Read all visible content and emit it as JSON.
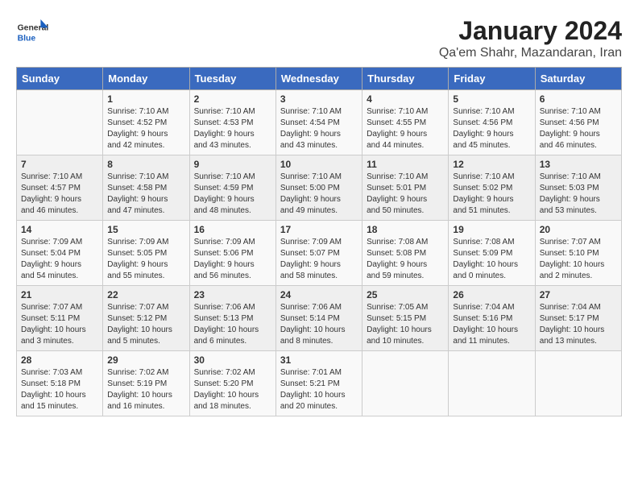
{
  "header": {
    "logo_general": "General",
    "logo_blue": "Blue",
    "title": "January 2024",
    "subtitle": "Qa'em Shahr, Mazandaran, Iran"
  },
  "calendar": {
    "days_of_week": [
      "Sunday",
      "Monday",
      "Tuesday",
      "Wednesday",
      "Thursday",
      "Friday",
      "Saturday"
    ],
    "weeks": [
      [
        {
          "day": "",
          "content": ""
        },
        {
          "day": "1",
          "content": "Sunrise: 7:10 AM\nSunset: 4:52 PM\nDaylight: 9 hours\nand 42 minutes."
        },
        {
          "day": "2",
          "content": "Sunrise: 7:10 AM\nSunset: 4:53 PM\nDaylight: 9 hours\nand 43 minutes."
        },
        {
          "day": "3",
          "content": "Sunrise: 7:10 AM\nSunset: 4:54 PM\nDaylight: 9 hours\nand 43 minutes."
        },
        {
          "day": "4",
          "content": "Sunrise: 7:10 AM\nSunset: 4:55 PM\nDaylight: 9 hours\nand 44 minutes."
        },
        {
          "day": "5",
          "content": "Sunrise: 7:10 AM\nSunset: 4:56 PM\nDaylight: 9 hours\nand 45 minutes."
        },
        {
          "day": "6",
          "content": "Sunrise: 7:10 AM\nSunset: 4:56 PM\nDaylight: 9 hours\nand 46 minutes."
        }
      ],
      [
        {
          "day": "7",
          "content": "Sunrise: 7:10 AM\nSunset: 4:57 PM\nDaylight: 9 hours\nand 46 minutes."
        },
        {
          "day": "8",
          "content": "Sunrise: 7:10 AM\nSunset: 4:58 PM\nDaylight: 9 hours\nand 47 minutes."
        },
        {
          "day": "9",
          "content": "Sunrise: 7:10 AM\nSunset: 4:59 PM\nDaylight: 9 hours\nand 48 minutes."
        },
        {
          "day": "10",
          "content": "Sunrise: 7:10 AM\nSunset: 5:00 PM\nDaylight: 9 hours\nand 49 minutes."
        },
        {
          "day": "11",
          "content": "Sunrise: 7:10 AM\nSunset: 5:01 PM\nDaylight: 9 hours\nand 50 minutes."
        },
        {
          "day": "12",
          "content": "Sunrise: 7:10 AM\nSunset: 5:02 PM\nDaylight: 9 hours\nand 51 minutes."
        },
        {
          "day": "13",
          "content": "Sunrise: 7:10 AM\nSunset: 5:03 PM\nDaylight: 9 hours\nand 53 minutes."
        }
      ],
      [
        {
          "day": "14",
          "content": "Sunrise: 7:09 AM\nSunset: 5:04 PM\nDaylight: 9 hours\nand 54 minutes."
        },
        {
          "day": "15",
          "content": "Sunrise: 7:09 AM\nSunset: 5:05 PM\nDaylight: 9 hours\nand 55 minutes."
        },
        {
          "day": "16",
          "content": "Sunrise: 7:09 AM\nSunset: 5:06 PM\nDaylight: 9 hours\nand 56 minutes."
        },
        {
          "day": "17",
          "content": "Sunrise: 7:09 AM\nSunset: 5:07 PM\nDaylight: 9 hours\nand 58 minutes."
        },
        {
          "day": "18",
          "content": "Sunrise: 7:08 AM\nSunset: 5:08 PM\nDaylight: 9 hours\nand 59 minutes."
        },
        {
          "day": "19",
          "content": "Sunrise: 7:08 AM\nSunset: 5:09 PM\nDaylight: 10 hours\nand 0 minutes."
        },
        {
          "day": "20",
          "content": "Sunrise: 7:07 AM\nSunset: 5:10 PM\nDaylight: 10 hours\nand 2 minutes."
        }
      ],
      [
        {
          "day": "21",
          "content": "Sunrise: 7:07 AM\nSunset: 5:11 PM\nDaylight: 10 hours\nand 3 minutes."
        },
        {
          "day": "22",
          "content": "Sunrise: 7:07 AM\nSunset: 5:12 PM\nDaylight: 10 hours\nand 5 minutes."
        },
        {
          "day": "23",
          "content": "Sunrise: 7:06 AM\nSunset: 5:13 PM\nDaylight: 10 hours\nand 6 minutes."
        },
        {
          "day": "24",
          "content": "Sunrise: 7:06 AM\nSunset: 5:14 PM\nDaylight: 10 hours\nand 8 minutes."
        },
        {
          "day": "25",
          "content": "Sunrise: 7:05 AM\nSunset: 5:15 PM\nDaylight: 10 hours\nand 10 minutes."
        },
        {
          "day": "26",
          "content": "Sunrise: 7:04 AM\nSunset: 5:16 PM\nDaylight: 10 hours\nand 11 minutes."
        },
        {
          "day": "27",
          "content": "Sunrise: 7:04 AM\nSunset: 5:17 PM\nDaylight: 10 hours\nand 13 minutes."
        }
      ],
      [
        {
          "day": "28",
          "content": "Sunrise: 7:03 AM\nSunset: 5:18 PM\nDaylight: 10 hours\nand 15 minutes."
        },
        {
          "day": "29",
          "content": "Sunrise: 7:02 AM\nSunset: 5:19 PM\nDaylight: 10 hours\nand 16 minutes."
        },
        {
          "day": "30",
          "content": "Sunrise: 7:02 AM\nSunset: 5:20 PM\nDaylight: 10 hours\nand 18 minutes."
        },
        {
          "day": "31",
          "content": "Sunrise: 7:01 AM\nSunset: 5:21 PM\nDaylight: 10 hours\nand 20 minutes."
        },
        {
          "day": "",
          "content": ""
        },
        {
          "day": "",
          "content": ""
        },
        {
          "day": "",
          "content": ""
        }
      ]
    ]
  }
}
